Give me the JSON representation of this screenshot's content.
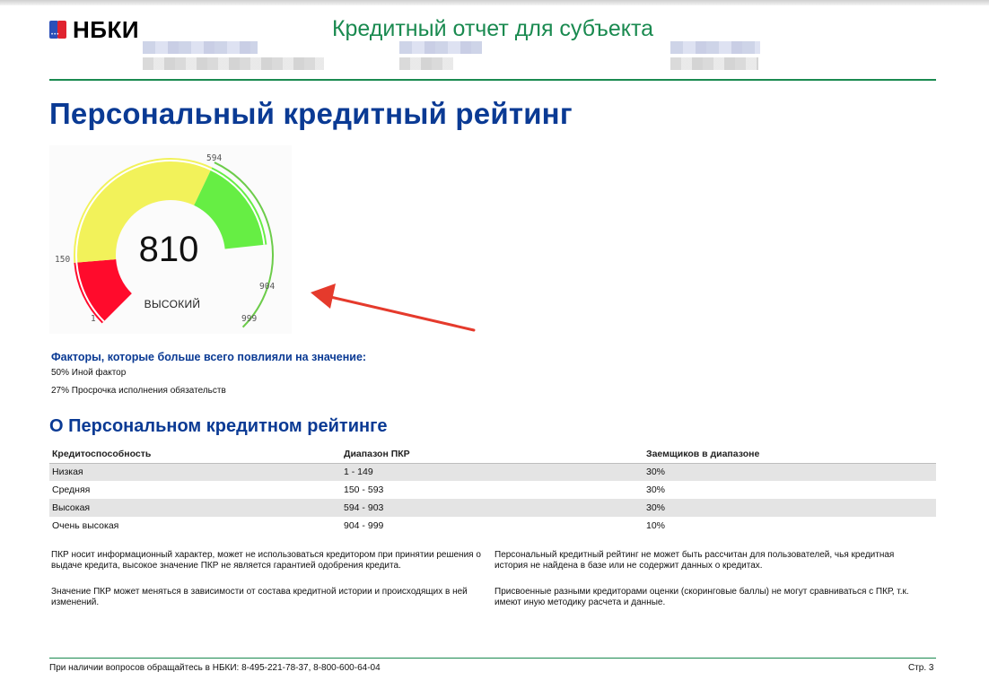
{
  "header": {
    "logo_text": "НБКИ",
    "title": "Кредитный отчет для субъекта"
  },
  "page_title": "Персональный кредитный рейтинг",
  "gauge": {
    "score": "810",
    "rating_label": "ВЫСОКИЙ",
    "scale_value": 810,
    "scale_min": 1,
    "scale_max": 999,
    "tick_labels": {
      "t1": "1",
      "t150": "150",
      "t594": "594",
      "t904": "904",
      "t999": "999"
    },
    "colors": {
      "low": "#ff0b2c",
      "mid": "#f2f25a",
      "high": "#66ee44",
      "track": "#6ccc4a"
    }
  },
  "factors": {
    "title": "Факторы, которые больше всего повлияли на значение:",
    "items": [
      "50% Иной фактор",
      "27% Просрочка исполнения обязательств"
    ]
  },
  "about": {
    "title": "О Персональном кредитном рейтинге",
    "headers": [
      "Кредитоспособность",
      "Диапазон ПКР",
      "Заемщиков в диапазоне"
    ],
    "rows": [
      [
        "Низкая",
        "1 - 149",
        "30%"
      ],
      [
        "Средняя",
        "150 - 593",
        "30%"
      ],
      [
        "Высокая",
        "594 - 903",
        "30%"
      ],
      [
        "Очень высокая",
        "904 - 999",
        "10%"
      ]
    ]
  },
  "notes": {
    "left": [
      "ПКР носит информационный характер, может не использоваться кредитором при принятии решения о выдаче кредита, высокое значение ПКР не является гарантией одобрения кредита.",
      "Значение ПКР может меняться в зависимости от состава кредитной истории и происходящих в ней изменений."
    ],
    "right": [
      "Персональный кредитный рейтинг не может быть рассчитан для пользователей, чья кредитная история не найдена в базе или не содержит данных о кредитах.",
      "Присвоенные разными кредиторами оценки (скоринговые баллы) не могут сравниваться с ПКР, т.к. имеют иную методику расчета и данные."
    ]
  },
  "footer": {
    "contact": "При наличии вопросов обращайтесь в НБКИ: 8-495-221-78-37, 8-800-600-64-04",
    "page": "Стр. 3"
  },
  "colors": {
    "green": "#1a8a50",
    "blue": "#0a3a94",
    "arrow": "#e53a2c"
  }
}
